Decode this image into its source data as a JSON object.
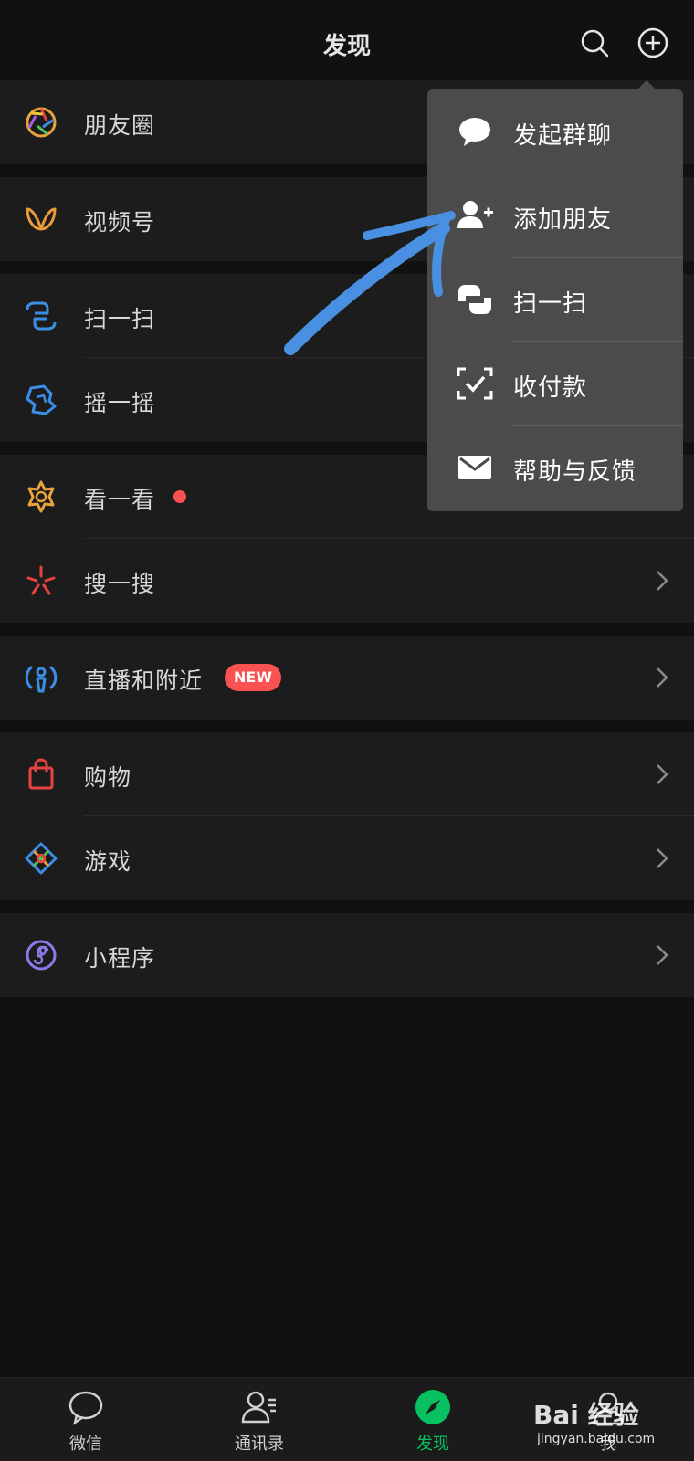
{
  "header": {
    "title": "发现",
    "search_icon": "search-icon",
    "add_icon": "plus-circle-icon"
  },
  "groups": [
    {
      "items": [
        {
          "label": "朋友圈",
          "icon": "moments-icon"
        }
      ]
    },
    {
      "items": [
        {
          "label": "视频号",
          "icon": "channels-icon"
        }
      ]
    },
    {
      "items": [
        {
          "label": "扫一扫",
          "icon": "scan-icon"
        },
        {
          "label": "摇一摇",
          "icon": "shake-icon"
        }
      ]
    },
    {
      "items": [
        {
          "label": "看一看",
          "icon": "top-stories-icon",
          "red_dot": true
        },
        {
          "label": "搜一搜",
          "icon": "search-feature-icon"
        }
      ]
    },
    {
      "items": [
        {
          "label": "直播和附近",
          "icon": "live-nearby-icon",
          "badge": "NEW"
        }
      ]
    },
    {
      "items": [
        {
          "label": "购物",
          "icon": "shopping-bag-icon"
        },
        {
          "label": "游戏",
          "icon": "games-icon"
        }
      ]
    },
    {
      "items": [
        {
          "label": "小程序",
          "icon": "mini-program-icon"
        }
      ]
    }
  ],
  "popup_menu": {
    "items": [
      {
        "label": "发起群聊",
        "icon": "chat-bubble-icon"
      },
      {
        "label": "添加朋友",
        "icon": "add-friend-icon"
      },
      {
        "label": "扫一扫",
        "icon": "scan-icon"
      },
      {
        "label": "收付款",
        "icon": "payment-icon"
      },
      {
        "label": "帮助与反馈",
        "icon": "mail-icon"
      }
    ]
  },
  "tabbar": {
    "tabs": [
      {
        "label": "微信",
        "icon": "chat-icon"
      },
      {
        "label": "通讯录",
        "icon": "contacts-icon"
      },
      {
        "label": "发现",
        "icon": "compass-icon",
        "active": true
      },
      {
        "label": "我",
        "icon": "me-icon"
      }
    ]
  },
  "watermark": {
    "logo": "Bai 经验",
    "url": "jingyan.baidu.com"
  },
  "colors": {
    "accent": "#07c160",
    "badge": "#fa5151",
    "annotation_arrow": "#4a90e2"
  }
}
